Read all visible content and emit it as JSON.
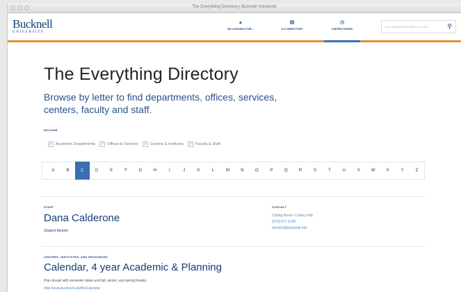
{
  "window": {
    "title": "The Everything Directory | Bucknell University"
  },
  "header": {
    "logo_name": "Bucknell",
    "logo_sub": "UNIVERSITY",
    "nav": [
      {
        "icon": "mountain-icon",
        "glyph": "▲",
        "label": "I'M LOOKING FOR..."
      },
      {
        "icon": "grid-icon",
        "glyph": "▤",
        "label": "A-Z DIRECTORY"
      },
      {
        "icon": "clock-icon",
        "glyph": "◷",
        "label": "VISITED PAGES"
      }
    ],
    "search_placeholder": "Find Departments, Offices, People",
    "search_icon": "search-icon"
  },
  "main": {
    "title": "The Everything Directory",
    "subtitle": "Browse by letter to find departments, offices, services, centers, faculty and staff.",
    "include_label": "INCLUDE",
    "filters": [
      "Academic Departments",
      "Offices & Services",
      "Centers & Institutes",
      "Faculty & Staff"
    ],
    "letters": [
      "A",
      "B",
      "C",
      "D",
      "E",
      "F",
      "G",
      "H",
      "I",
      "J",
      "K",
      "L",
      "M",
      "N",
      "O",
      "P",
      "Q",
      "R",
      "S",
      "T",
      "U",
      "V",
      "W",
      "X",
      "Y",
      "Z"
    ],
    "active_letter": "C"
  },
  "results": [
    {
      "category": "STAFF",
      "name": "Dana Calderone",
      "role": "Student Monitor",
      "contact_label": "CONTACT",
      "contact_lines": [
        "Calling Room- Cooley Hall",
        "(570) 577 3138",
        "dmc052@bucknell.edu"
      ]
    },
    {
      "category": "CENTERS, INSTITUTES, AND RESOURCES",
      "name": "Calendar, 4 year Academic & Planning",
      "desc": "Plan ahead with semester dates and fall, winter, and spring breaks.",
      "url": "http://www.bucknell.edu/theCalendar"
    }
  ],
  "colors": {
    "brand_blue": "#123d76",
    "accent_orange": "#e98f2a",
    "link_blue": "#3a6fb1"
  }
}
